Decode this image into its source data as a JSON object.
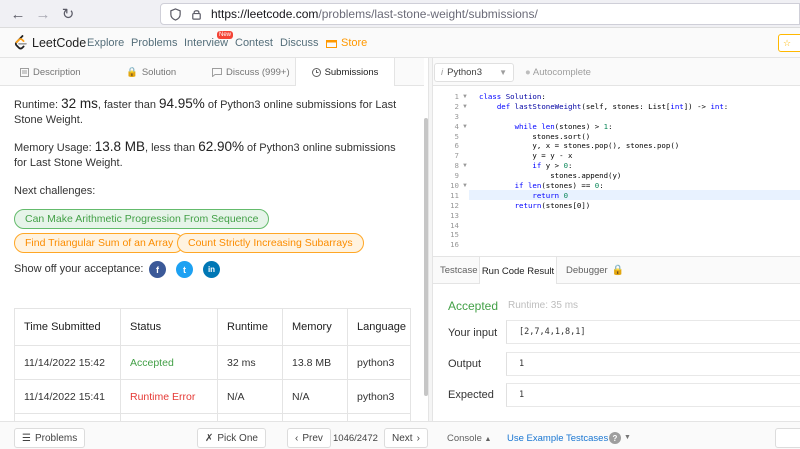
{
  "browser": {
    "url_host": "https://leetcode.com",
    "url_path": "/problems/last-stone-weight/submissions/"
  },
  "nav": {
    "logo": "LeetCode",
    "links": [
      "Explore",
      "Problems",
      "Interview",
      "Contest",
      "Discuss"
    ],
    "new_badge": "New",
    "store": "Store"
  },
  "left_tabs": {
    "description": "Description",
    "solution": "Solution",
    "discuss": "Discuss (999+)",
    "submissions": "Submissions"
  },
  "stats": {
    "runtime_label": "Runtime:",
    "runtime_value": "32 ms",
    "runtime_mid": ", faster than",
    "runtime_pct": "94.95%",
    "runtime_tail": "of Python3 online submissions for Last Stone Weight.",
    "memory_label": "Memory Usage:",
    "memory_value": "13.8 MB",
    "memory_mid": ", less than",
    "memory_pct": "62.90%",
    "memory_tail": "of Python3 online submissions for Last Stone Weight."
  },
  "challenges": {
    "label": "Next challenges:",
    "items": [
      "Can Make Arithmetic Progression From Sequence",
      "Find Triangular Sum of an Array",
      "Count Strictly Increasing Subarrays"
    ]
  },
  "share": {
    "label": "Show off your acceptance:",
    "facebook": "f",
    "twitter": "t",
    "linkedin": "in"
  },
  "submissions_table": {
    "headers": [
      "Time Submitted",
      "Status",
      "Runtime",
      "Memory",
      "Language"
    ],
    "rows": [
      [
        "11/14/2022 15:42",
        "Accepted",
        "32 ms",
        "13.8 MB",
        "python3"
      ],
      [
        "11/14/2022 15:41",
        "Runtime Error",
        "N/A",
        "N/A",
        "python3"
      ]
    ]
  },
  "editor": {
    "language": "Python3",
    "autocomplete": "Autocomplete",
    "line_numbers": [
      "1",
      "2",
      "3",
      "4",
      "5",
      "6",
      "7",
      "8",
      "9",
      "10",
      "11",
      "12",
      "13",
      "14",
      "15",
      "16"
    ],
    "code": [
      "class Solution:",
      "    def lastStoneWeight(self, stones: List[int]) -> int:",
      "",
      "        while len(stones) > 1:",
      "            stones.sort()",
      "            y, x = stones.pop(), stones.pop()",
      "            y = y - x",
      "            if y > 0:",
      "                stones.append(y)",
      "        if len(stones) == 0:",
      "            return 0",
      "        return(stones[0])",
      "",
      "",
      "",
      ""
    ]
  },
  "result_tabs": {
    "testcase": "Testcase",
    "run_code_result": "Run Code Result",
    "debugger": "Debugger"
  },
  "result": {
    "status": "Accepted",
    "runtime": "Runtime: 35 ms",
    "input_label": "Your input",
    "input_value": "[2,7,4,1,8,1]",
    "output_label": "Output",
    "output_value": "1",
    "expected_label": "Expected",
    "expected_value": "1"
  },
  "bottom": {
    "problems": "Problems",
    "pick_one": "Pick One",
    "prev": "Prev",
    "page": "1046/2472",
    "next": "Next",
    "console": "Console",
    "use_example": "Use Example Testcases"
  }
}
